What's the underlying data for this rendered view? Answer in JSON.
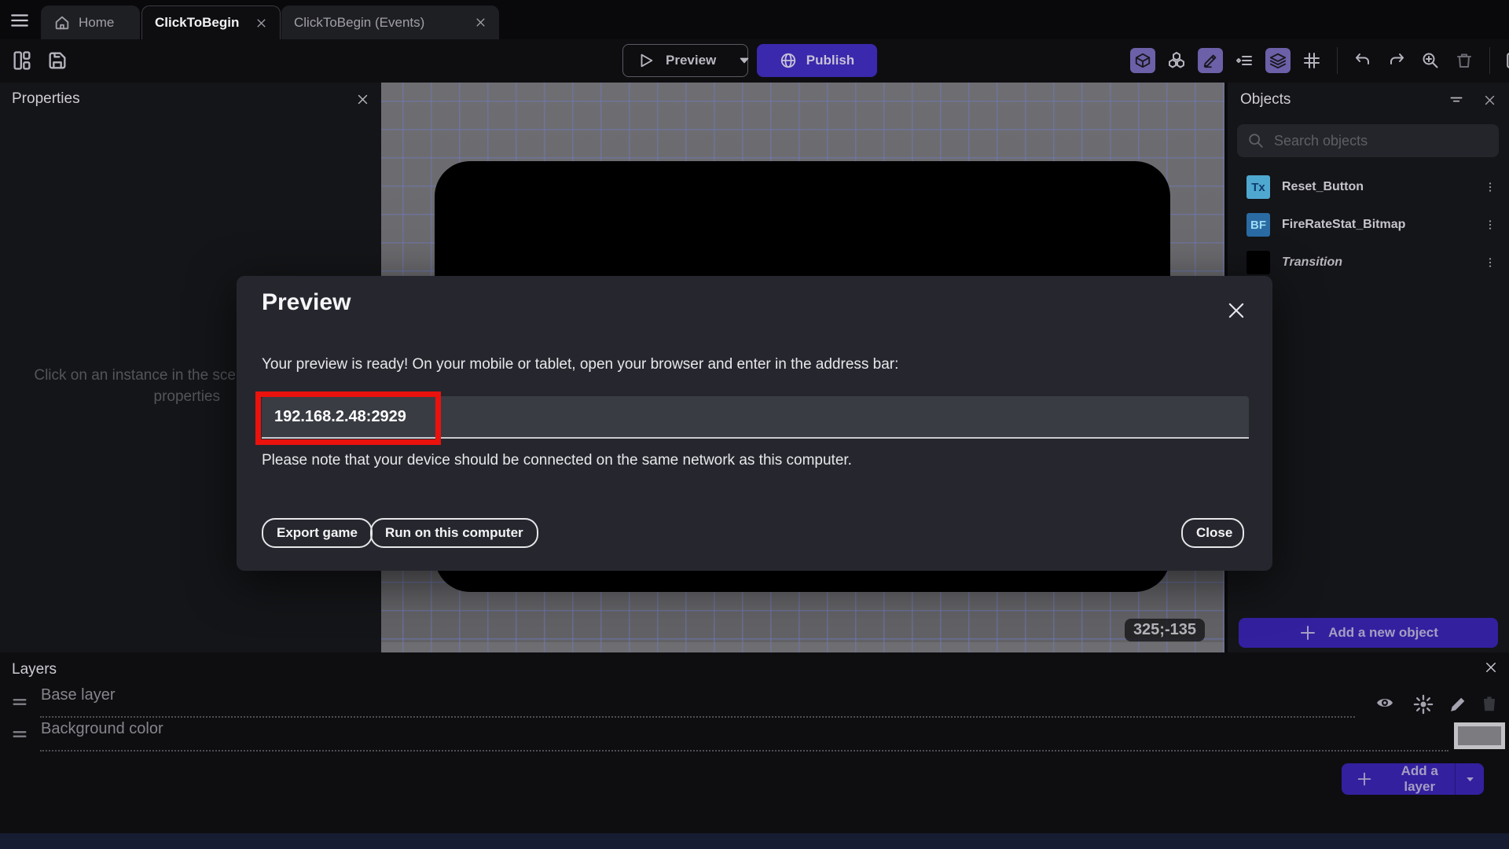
{
  "tabbar": {
    "home_label": "Home",
    "scene_tab_label": "ClickToBegin",
    "events_tab_label": "ClickToBegin (Events)"
  },
  "toolbar": {
    "preview_label": "Preview",
    "publish_label": "Publish"
  },
  "properties_panel": {
    "title": "Properties",
    "placeholder_line1": "Click on an instance in the sce",
    "placeholder_line2": "properties"
  },
  "canvas": {
    "coordinates_badge": "325;-135"
  },
  "objects_panel": {
    "title": "Objects",
    "search_placeholder": "Search objects",
    "items": [
      {
        "label": "Reset_Button",
        "icon_text": "Tx"
      },
      {
        "label": "FireRateStat_Bitmap",
        "icon_text": "BF"
      },
      {
        "label": "Transition",
        "icon_text": ""
      }
    ],
    "add_object_label": "Add a new object"
  },
  "modal": {
    "title": "Preview",
    "body_text": "Your preview is ready! On your mobile or tablet, open your browser and enter in the address bar:",
    "address_value": "192.168.2.48:2929",
    "note_text": "Please note that your device should be connected on the same network as this computer.",
    "export_label": "Export game",
    "run_label": "Run on this computer",
    "close_label": "Close"
  },
  "layers_panel": {
    "title": "Layers",
    "layers": [
      {
        "name": "Base layer"
      },
      {
        "name": "Background color"
      }
    ],
    "add_layer_label": "Add a layer"
  },
  "colors": {
    "accent_purple": "#3a28ad",
    "button_purple": "#33209f",
    "toolbar_highlight_purple": "#6c60a8",
    "annotation_red": "#ea120d",
    "canvas_gray": "#6a6a6e",
    "grid_blue": "#6f7ac0"
  }
}
